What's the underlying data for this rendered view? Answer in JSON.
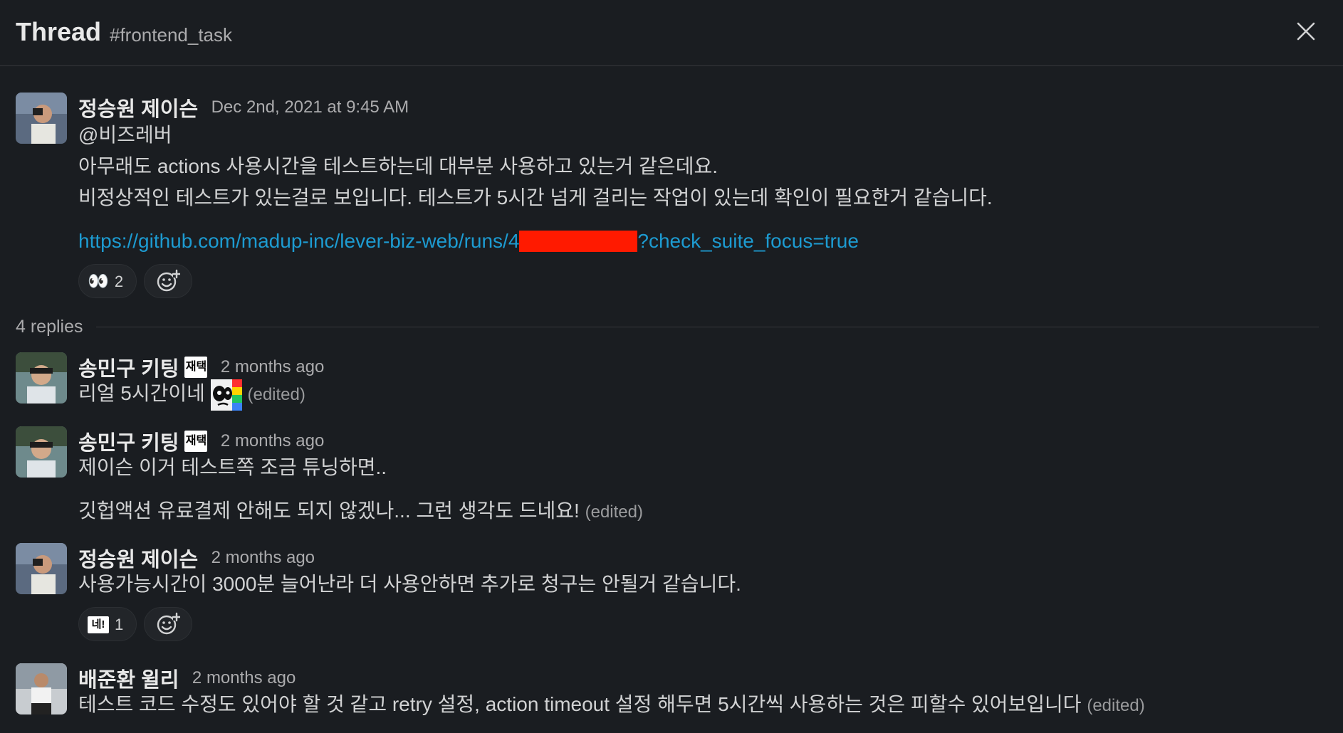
{
  "header": {
    "title": "Thread",
    "channel": "#frontend_task",
    "close_icon": "close-icon"
  },
  "parent": {
    "author": "정승원 제이슨",
    "timestamp": "Dec 2nd, 2021 at 9:45 AM",
    "lines": [
      "@비즈레버",
      "아무래도 actions 사용시간을 테스트하는데 대부분 사용하고 있는거 같은데요.",
      "비정상적인 테스트가 있는걸로 보입니다. 테스트가 5시간 넘게 걸리는 작업이 있는데 확인이 필요한거 같습니다."
    ],
    "link_prefix": "https://github.com/madup-inc/lever-biz-web/runs/4",
    "link_suffix": "?check_suite_focus=true",
    "reaction": {
      "emoji": "👀",
      "count": "2"
    }
  },
  "replies_label": "4 replies",
  "replies": [
    {
      "author": "송민구 키팅",
      "badge": "재택",
      "timestamp": "2 months ago",
      "text": "리얼 5시간이네",
      "edited": "(edited)"
    },
    {
      "author": "송민구 키팅",
      "badge": "재택",
      "timestamp": "2 months ago",
      "text": "제이슨 이거 테스트쪽 조금 튜닝하면..",
      "text2": "깃헙액션 유료결제 안해도 되지 않겠나... 그런 생각도 드네요!",
      "edited": "(edited)"
    },
    {
      "author": "정승원 제이슨",
      "timestamp": "2 months ago",
      "text": "사용가능시간이 3000분 늘어난라 더 사용안하면 추가로 청구는 안될거 같습니다.",
      "reaction": {
        "emoji": "네!",
        "count": "1"
      }
    },
    {
      "author": "배준환 윌리",
      "timestamp": "2 months ago",
      "text": "테스트 코드 수정도 있어야 할 것 같고 retry 설정,  action timeout 설정 해두면 5시간씩 사용하는 것은 피할수 있어보입니다",
      "edited": "(edited)"
    }
  ],
  "colors": {
    "background": "#1a1d21",
    "link": "#1d9bd1",
    "redaction": "#ff1a00"
  }
}
